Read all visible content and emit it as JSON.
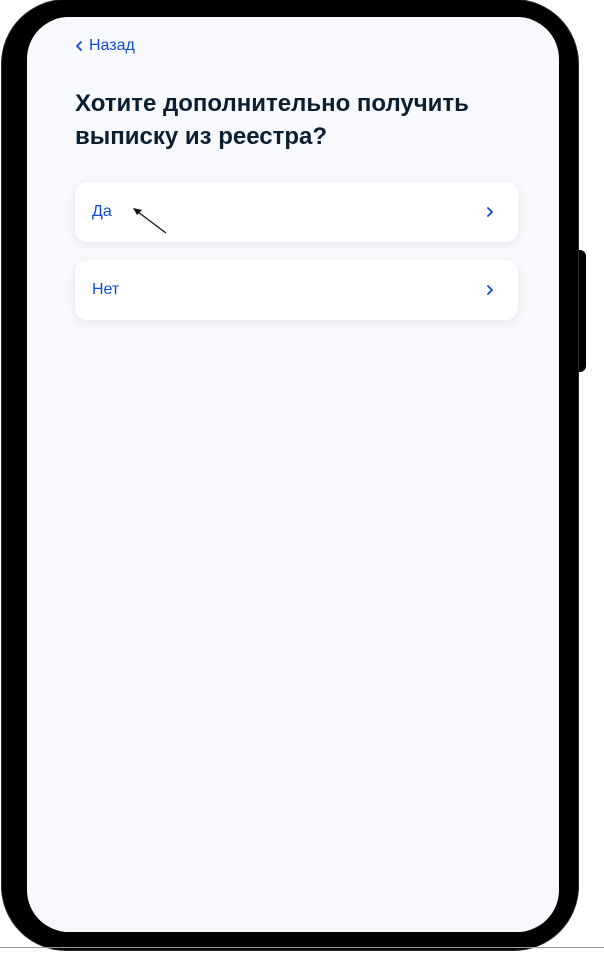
{
  "header": {
    "back_label": "Назад",
    "back_icon": "chevron-left-icon"
  },
  "main": {
    "title": "Хотите дополнительно получить выписку из реестра?",
    "options": [
      {
        "label": "Да",
        "icon": "chevron-right-icon"
      },
      {
        "label": "Нет",
        "icon": "chevron-right-icon"
      }
    ]
  },
  "colors": {
    "accent": "#0d4cd3",
    "text_primary": "#0b1f33",
    "background": "#f8f9fc",
    "card": "#ffffff",
    "frame": "#000000"
  }
}
